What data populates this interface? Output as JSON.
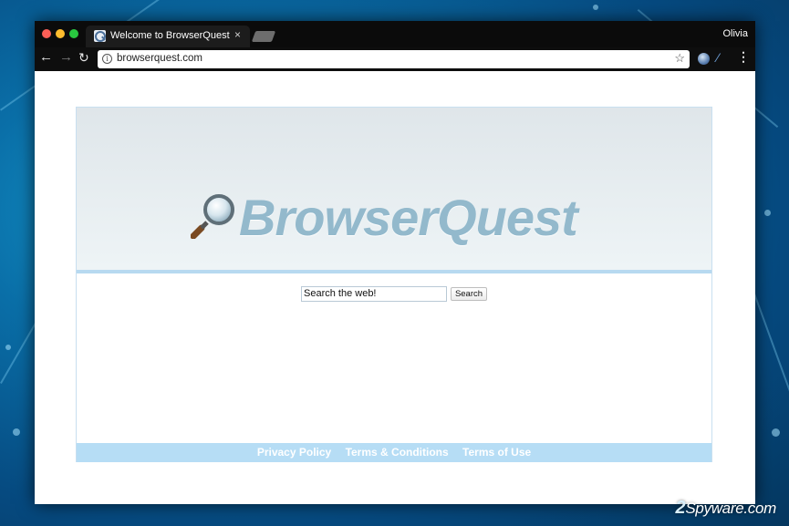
{
  "tab": {
    "title": "Welcome to BrowserQuest",
    "close": "×"
  },
  "profile": {
    "name": "Olivia"
  },
  "toolbar": {
    "back": "←",
    "forward": "→",
    "reload": "↻",
    "info": "i",
    "url": "browserquest.com",
    "star": "☆",
    "menu": "⋮"
  },
  "page": {
    "logo_text": "BrowserQuest",
    "search_value": "Search the web!",
    "search_button": "Search",
    "footer_links": [
      "Privacy Policy",
      "Terms & Conditions",
      "Terms of Use"
    ]
  },
  "watermark": {
    "num": "2",
    "text": "Spyware.com"
  },
  "colors": {
    "logo": "#93b9cc",
    "footer_bar": "#b6ddf5",
    "titlebar": "#0b0b0b"
  }
}
